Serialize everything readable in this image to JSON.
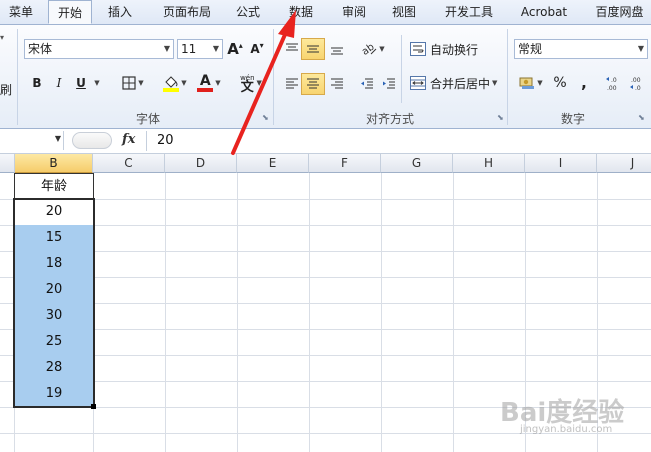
{
  "ribbon_tabs": [
    {
      "id": "menu",
      "label": "菜单"
    },
    {
      "id": "home",
      "label": "开始",
      "active": true
    },
    {
      "id": "insert",
      "label": "插入"
    },
    {
      "id": "layout",
      "label": "页面布局"
    },
    {
      "id": "formulas",
      "label": "公式"
    },
    {
      "id": "data",
      "label": "数据"
    },
    {
      "id": "review",
      "label": "审阅"
    },
    {
      "id": "view",
      "label": "视图"
    },
    {
      "id": "developer",
      "label": "开发工具"
    },
    {
      "id": "acrobat",
      "label": "Acrobat"
    },
    {
      "id": "baidu",
      "label": "百度网盘"
    }
  ],
  "font_group": {
    "label": "字体",
    "font_name": "宋体",
    "font_size": "11",
    "bold": "B",
    "italic": "I",
    "underline": "U",
    "grow_font": "A",
    "shrink_font": "A",
    "font_color_glyph": "A",
    "wen_glyph": "文",
    "wen_sub": "wén",
    "fill_color": "#ffff00",
    "font_color": "#e0201c"
  },
  "align_group": {
    "label": "对齐方式",
    "wrap_text": "自动换行",
    "merge_center": "合并后居中"
  },
  "number_group": {
    "label": "数字",
    "format": "常规",
    "percent": "%",
    "comma": ","
  },
  "left_stub": {
    "label": "刷"
  },
  "formula_bar": {
    "fx": "fx",
    "value": "20"
  },
  "columns": [
    "B",
    "C",
    "D",
    "E",
    "F",
    "G",
    "H",
    "I",
    "J"
  ],
  "selected_column": "B",
  "table": {
    "header": "年龄",
    "values": [
      "20",
      "15",
      "18",
      "20",
      "30",
      "25",
      "28",
      "19"
    ]
  },
  "watermark": {
    "text": "Bai度经验",
    "sub": "jingyan.baidu.com"
  },
  "colors": {
    "selection": "#a8cdef",
    "annotation_arrow": "#e8231f",
    "pressed": "#f8d470"
  }
}
